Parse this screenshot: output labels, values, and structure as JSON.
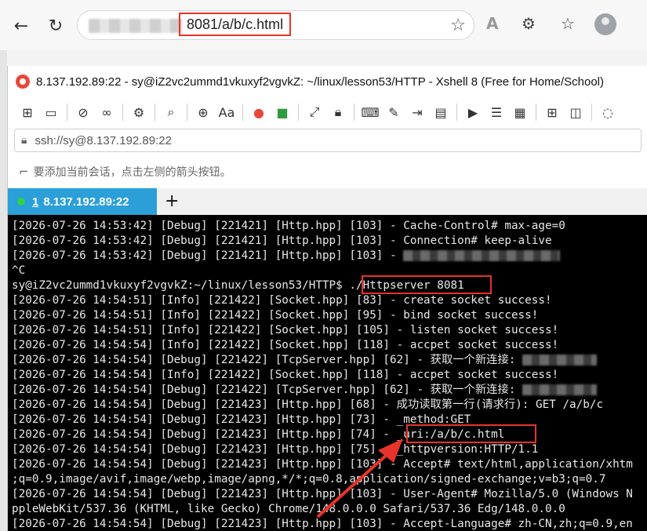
{
  "browser": {
    "url": "8081/a/b/c.html",
    "back_icon": "arrow-left-icon",
    "reload_icon": "reload-icon"
  },
  "xshell": {
    "title": "8.137.192.89:22 - sy@iZ2vc2ummd1vkuxyf2vgvkZ: ~/linux/lesson53/HTTP - Xshell 8 (Free for Home/School)",
    "address": "ssh://sy@8.137.192.89:22",
    "hint": "要添加当前会话，点击左侧的箭头按钮。",
    "tab_number": "1",
    "tab_label": "8.137.192.89:22",
    "new_tab": "+"
  },
  "terminal": {
    "lines": [
      "[2026-07-26 14:53:42] [Debug] [221421] [Http.hpp] [103] - Cache-Control# max-age=0",
      "[2026-07-26 14:53:42] [Debug] [221421] [Http.hpp] [103] - Connection# keep-alive",
      "[2026-07-26 14:53:42] [Debug] [221421] [Http.hpp] [103] - ",
      "^C",
      "sy@iZ2vc2ummd1vkuxyf2vgvkZ:~/linux/lesson53/HTTP$ ./Httpserver 8081",
      "[2026-07-26 14:54:51] [Info] [221422] [Socket.hpp] [83] - create socket success!",
      "[2026-07-26 14:54:51] [Info] [221422] [Socket.hpp] [95] - bind socket success!",
      "[2026-07-26 14:54:51] [Info] [221422] [Socket.hpp] [105] - listen socket success!",
      "[2026-07-26 14:54:54] [Info] [221422] [Socket.hpp] [118] - accpet socket success!",
      "[2026-07-26 14:54:54] [Debug] [221422] [TcpServer.hpp] [62] - 获取一个新连接: ",
      "[2026-07-26 14:54:54] [Info] [221422] [Socket.hpp] [118] - accpet socket success!",
      "[2026-07-26 14:54:54] [Debug] [221422] [TcpServer.hpp] [62] - 获取一个新连接: ",
      "[2026-07-26 14:54:54] [Debug] [221423] [Http.hpp] [68] - 成功读取第一行(请求行): GET /a/b/c",
      "[2026-07-26 14:54:54] [Debug] [221423] [Http.hpp] [73] - _method:GET",
      "[2026-07-26 14:54:54] [Debug] [221423] [Http.hpp] [74] - _uri:/a/b/c.html",
      "[2026-07-26 14:54:54] [Debug] [221423] [Http.hpp] [75] - _httpversion:HTTP/1.1",
      "[2026-07-26 14:54:54] [Debug] [221423] [Http.hpp] [103] - Accept# text/html,application/xhtm",
      ";q=0.9,image/avif,image/webp,image/apng,*/*;q=0.8,application/signed-exchange;v=b3;q=0.7",
      "[2026-07-26 14:54:54] [Debug] [221423] [Http.hpp] [103] - User-Agent# Mozilla/5.0 (Windows N",
      "ppleWebKit/537.36 (KHTML, like Gecko) Chrome/148.0.0.0 Safari/537.36 Edg/148.0.0.0",
      "[2026-07-26 14:54:54] [Debug] [221423] [Http.hpp] [103] - Accept-Language# zh-CN,zh;q=0.9,en"
    ]
  },
  "colors": {
    "highlight": "#e8332a",
    "tab_active": "#2a9fd8",
    "terminal_bg": "#000000",
    "terminal_fg": "#e8e8e8"
  }
}
